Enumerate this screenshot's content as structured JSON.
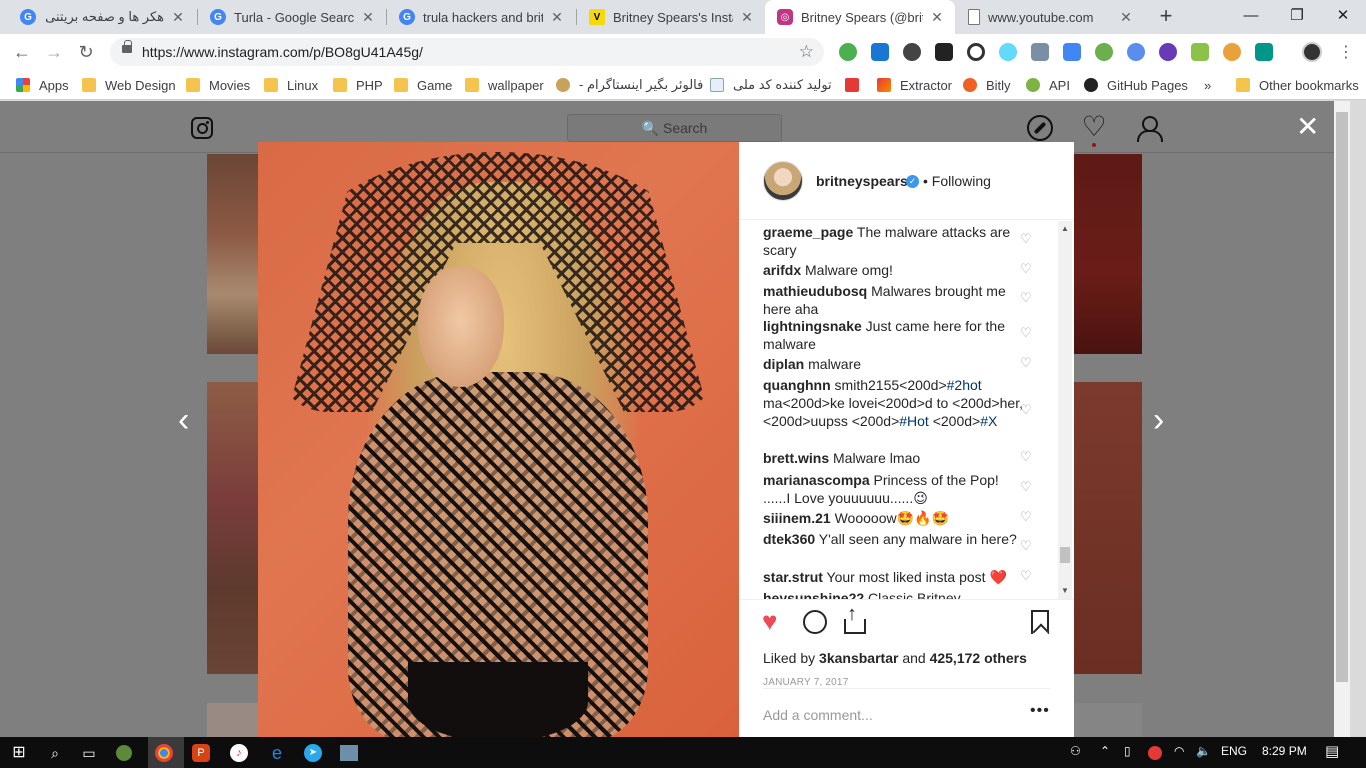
{
  "tabs": [
    {
      "label": "هکر ها و صفحه بریتنی ا",
      "favicon": "google-icon",
      "color": "#4285f4"
    },
    {
      "label": "Turla - Google Search",
      "favicon": "google-icon",
      "color": "#4285f4"
    },
    {
      "label": "trula hackers and britne",
      "favicon": "google-icon",
      "color": "#4285f4"
    },
    {
      "label": "Britney Spears's Instagr",
      "favicon": "vice-icon",
      "color": "#f5d90a"
    },
    {
      "label": "Britney Spears (@britne",
      "favicon": "instagram-icon",
      "color": "#c13584"
    },
    {
      "label": "www.youtube.com",
      "favicon": "page-icon",
      "color": "#ffffff"
    }
  ],
  "toolbar": {
    "url": "https://www.instagram.com/p/BO8gU41A45g/"
  },
  "bookmarks": [
    {
      "label": "Apps"
    },
    {
      "label": "Web Design"
    },
    {
      "label": "Movies"
    },
    {
      "label": "Linux"
    },
    {
      "label": "PHP"
    },
    {
      "label": "Game"
    },
    {
      "label": "wallpaper"
    },
    {
      "label": "فالوئر بگیر اینستاگرام -"
    },
    {
      "label": "تولید کننده کد ملی"
    },
    {
      "label": ""
    },
    {
      "label": "Extractor"
    },
    {
      "label": "Bitly"
    },
    {
      "label": "API"
    },
    {
      "label": "GitHub Pages"
    },
    {
      "label": "»"
    },
    {
      "label": "Other bookmarks"
    }
  ],
  "instagram": {
    "search_placeholder": "🔍 Search",
    "username": "britneyspears",
    "following": "Following",
    "comments": [
      {
        "user": "graeme_page",
        "text": " The malware attacks are scary"
      },
      {
        "user": "arifdx",
        "text": " Malware omg!"
      },
      {
        "user": "mathieudubosq",
        "text": " Malwares brought me here aha"
      },
      {
        "user": "lightningsnake",
        "text": " Just came here for the malware"
      },
      {
        "user": "diplan",
        "text": " malware"
      },
      {
        "user": "quanghnn",
        "text": " smith2155<200d>",
        "tag1": "#2hot",
        "text2": " ma<200d>ke lovei<200d>d to <200d>her, <200d>uupss <200d>",
        "tag2": "#Hot",
        "text3": " <200d>",
        "tag3": "#X"
      },
      {
        "user": "brett.wins",
        "text": " Malware lmao"
      },
      {
        "user": "marianascompa",
        "text": " Princess of the Pop! ......I Love youuuuuu......😉"
      },
      {
        "user": "siiinem.21",
        "text": " Wooooow🤩🔥🤩"
      },
      {
        "user": "dtek360",
        "text": " Y'all seen any malware in here?"
      },
      {
        "user": "star.strut",
        "text": " Your most liked insta post ❤️"
      },
      {
        "user": "heysunshine22",
        "text": " Classic Britney"
      }
    ],
    "likes_prefix": "Liked by ",
    "likes_user": "3kansbartar",
    "likes_and": " and ",
    "likes_count": "425,172 others",
    "date": "JANUARY 7, 2017",
    "add_comment_placeholder": "Add a comment...",
    "more": "•••"
  },
  "taskbar": {
    "language": "ENG",
    "time": "8:29 PM"
  }
}
